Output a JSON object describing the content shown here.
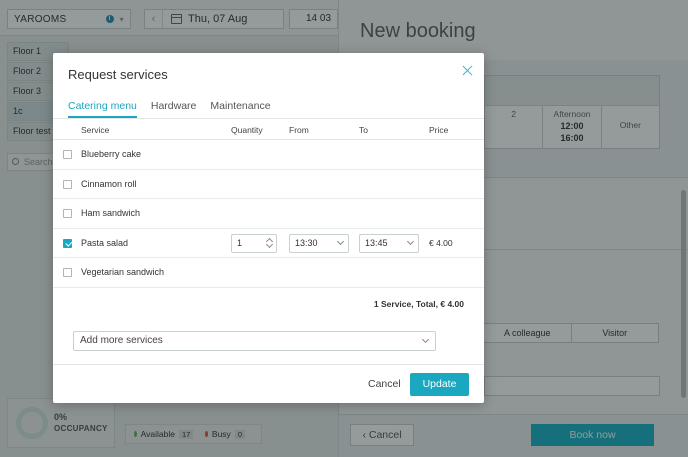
{
  "app": {
    "brand": "YAROOMS",
    "date": "Thu, 07 Aug",
    "time": "14 03",
    "floors": [
      "Floor 1",
      "Floor 2",
      "Floor 3",
      "1c",
      "Floor test"
    ],
    "search_placeholder": "Search",
    "occupancy": {
      "percent": "0%",
      "label": "OCCUPANCY"
    },
    "legend": {
      "available_label": "Available",
      "available_count": "17",
      "busy_label": "Busy",
      "busy_count": "0"
    }
  },
  "booking_panel": {
    "title": "New booking",
    "slot_partial": "2",
    "slots": {
      "afternoon_label": "Afternoon",
      "afternoon_from": "12:00",
      "afternoon_to": "16:00",
      "other_label": "Other"
    },
    "who_tabs": [
      "A colleague",
      "Visitor"
    ],
    "cancel_label": "Cancel",
    "book_label": "Book now"
  },
  "modal": {
    "title": "Request services",
    "tabs": [
      "Catering menu",
      "Hardware",
      "Maintenance"
    ],
    "columns": {
      "service": "Service",
      "quantity": "Quantity",
      "from": "From",
      "to": "To",
      "price": "Price"
    },
    "services": [
      {
        "name": "Blueberry cake"
      },
      {
        "name": "Cinnamon roll"
      },
      {
        "name": "Ham sandwich"
      },
      {
        "name": "Pasta salad",
        "quantity": "1",
        "from": "13:30",
        "to": "13:45",
        "price": "€ 4.00"
      },
      {
        "name": "Vegetarian sandwich"
      }
    ],
    "total": "1 Service, Total, € 4.00",
    "add_more": "Add more services",
    "cancel_label": "Cancel",
    "update_label": "Update"
  },
  "colors": {
    "accent": "#1aa7c0",
    "book_button": "#19b3c9"
  }
}
